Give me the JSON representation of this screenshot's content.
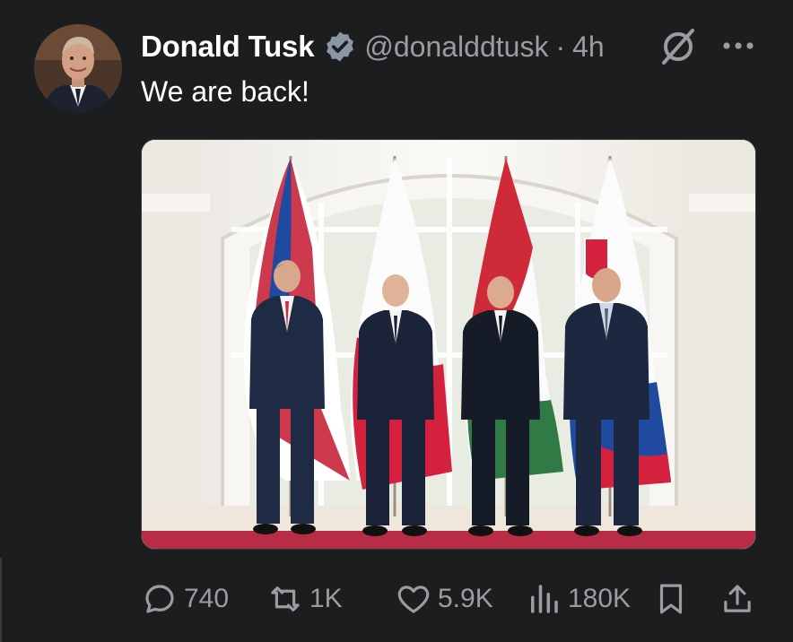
{
  "author": {
    "name": "Donald Tusk",
    "handle": "@donalddtusk",
    "verified": true,
    "time": "4h"
  },
  "tweet": {
    "text": "We are back!"
  },
  "header_icons": [
    "verified-badge-icon",
    "grok-icon",
    "more-options-icon"
  ],
  "actions": {
    "replies": "740",
    "reposts": "1K",
    "likes": "5.9K",
    "views": "180K"
  },
  "action_icons": [
    "reply-icon",
    "repost-icon",
    "like-icon",
    "views-icon",
    "bookmark-icon",
    "share-icon"
  ],
  "colors": {
    "background": "#1c1d1f",
    "text_primary": "#ffffff",
    "text_secondary": "#9a9c9f",
    "verified": "#8a96a5"
  }
}
